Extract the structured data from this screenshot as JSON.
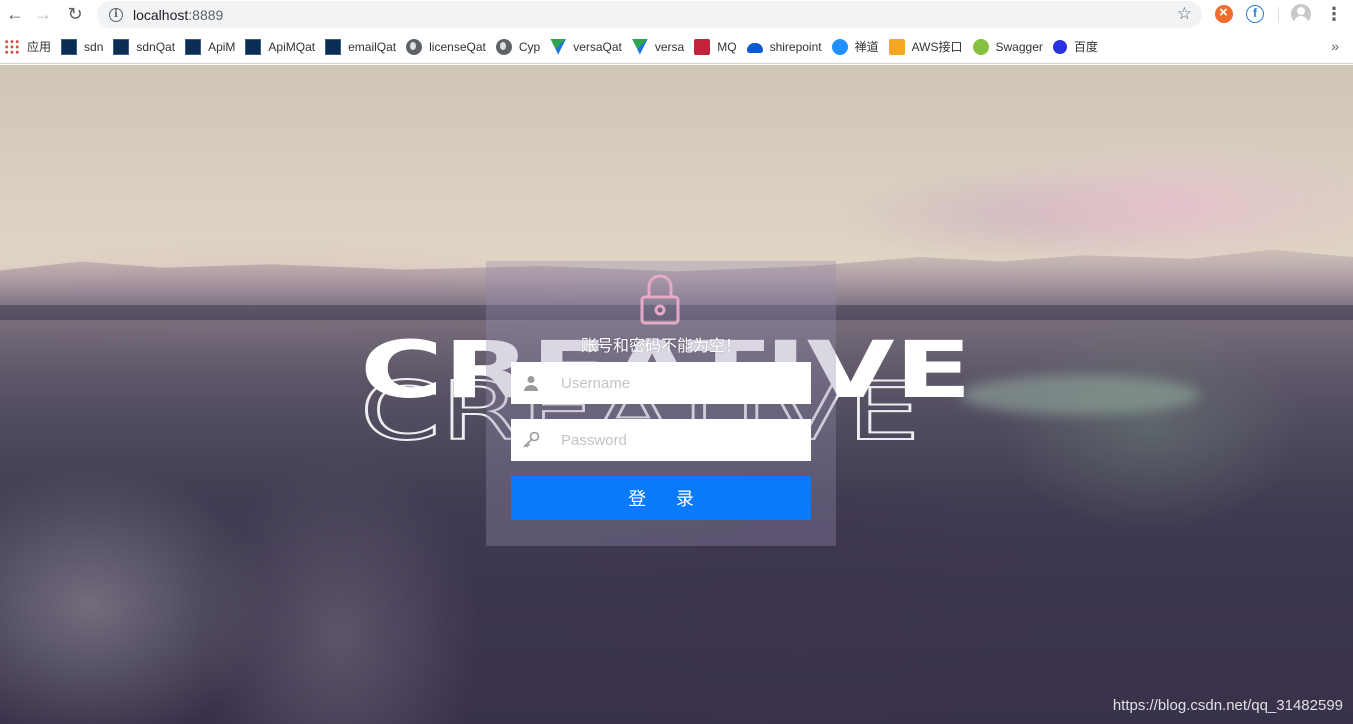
{
  "browser": {
    "url_host": "localhost",
    "url_port": ":8889"
  },
  "bookmarks": [
    {
      "label": "应用",
      "icon": "apps-grid-icon"
    },
    {
      "label": "sdn",
      "icon": "site-favicon"
    },
    {
      "label": "sdnQat",
      "icon": "site-favicon"
    },
    {
      "label": "ApiM",
      "icon": "site-favicon"
    },
    {
      "label": "ApiMQat",
      "icon": "site-favicon"
    },
    {
      "label": "emailQat",
      "icon": "site-favicon"
    },
    {
      "label": "licenseQat",
      "icon": "globe-icon"
    },
    {
      "label": "Cyp",
      "icon": "globe-icon"
    },
    {
      "label": "versaQat",
      "icon": "versa-icon"
    },
    {
      "label": "versa",
      "icon": "versa-icon"
    },
    {
      "label": "MQ",
      "icon": "mq-icon"
    },
    {
      "label": "shirepoint",
      "icon": "onedrive-icon"
    },
    {
      "label": "禅道",
      "icon": "chandao-icon"
    },
    {
      "label": "AWS接口",
      "icon": "aws-icon"
    },
    {
      "label": "Swagger",
      "icon": "swagger-icon"
    },
    {
      "label": "百度",
      "icon": "baidu-icon"
    }
  ],
  "login": {
    "background_word": "CREATIVE",
    "error_message": "账号和密码不能为空！",
    "username_placeholder": "Username",
    "password_placeholder": "Password",
    "submit_label": "登 录",
    "button_color": "#0a7afc"
  },
  "watermark": "https://blog.csdn.net/qq_31482599"
}
